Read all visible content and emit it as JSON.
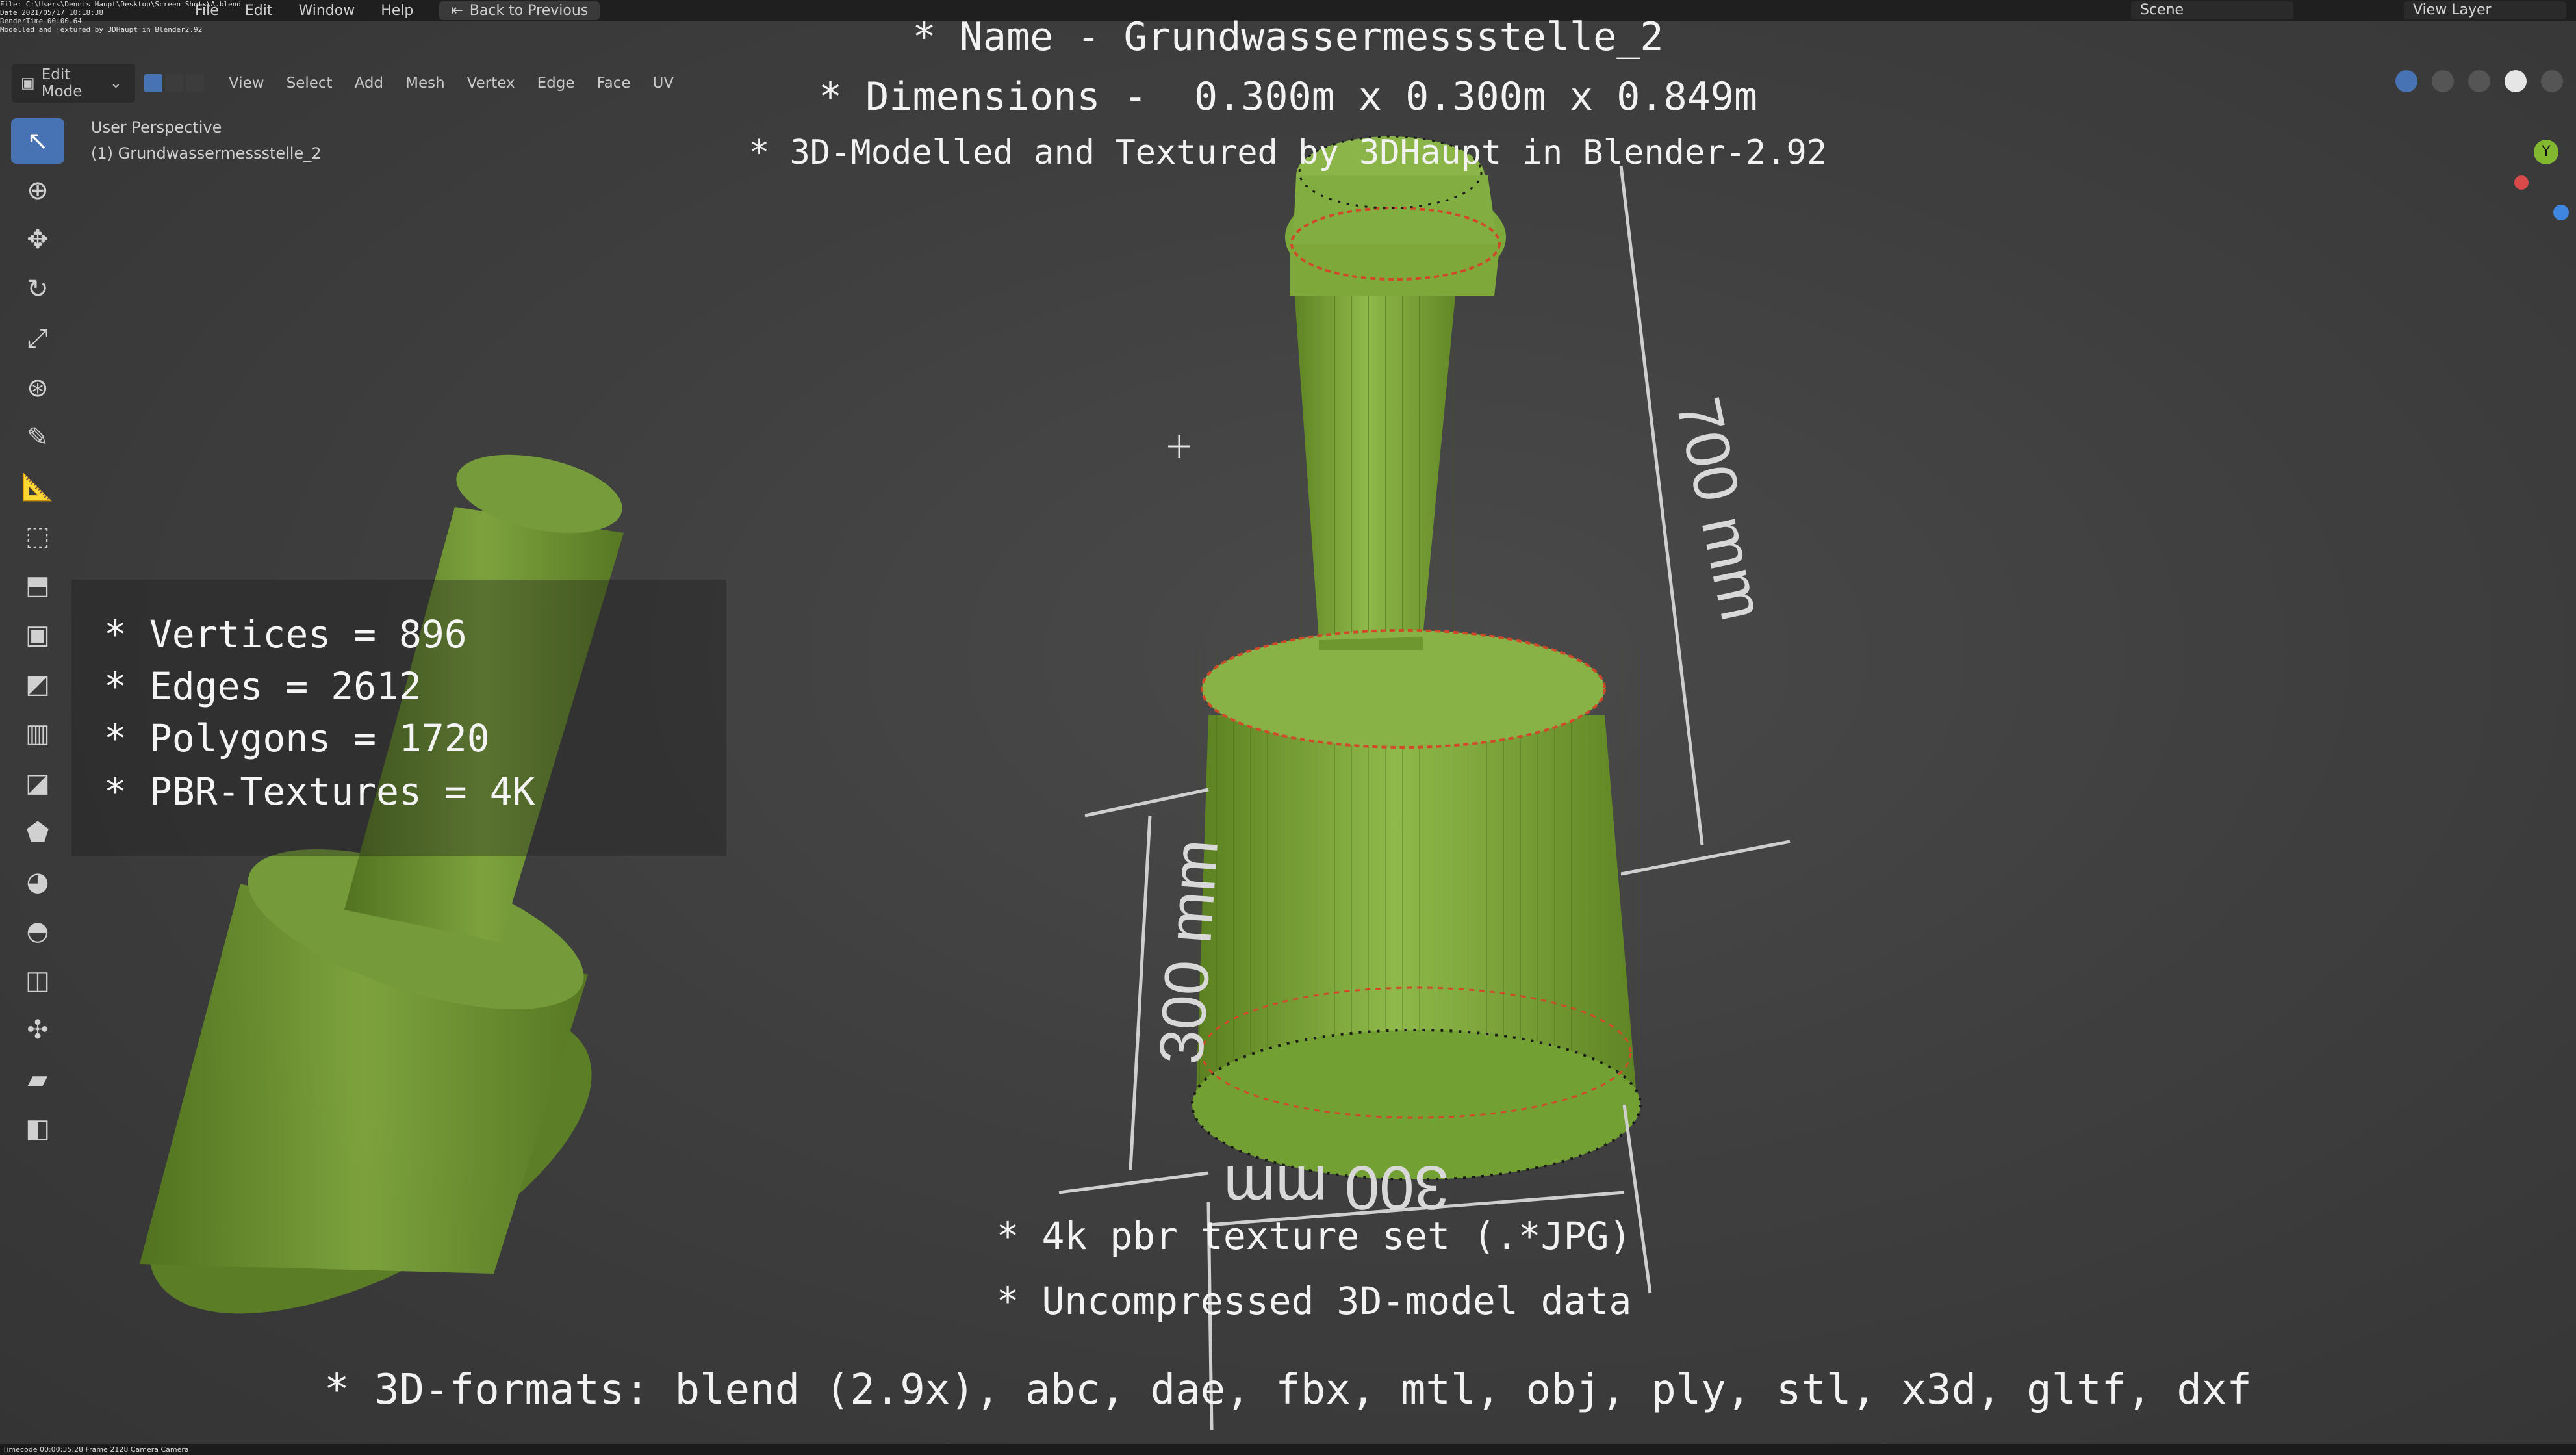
{
  "window": {
    "menu": [
      "File",
      "Edit",
      "Window",
      "Help"
    ],
    "back_label": "Back to Previous",
    "scene": "Scene",
    "view_layer": "View Layer",
    "tiny_info": "File: C:\\Users\\Dennis Haupt\\Desktop\\Screen Shots\\A.blend\nDate 2021/05/17 10:18:38\nRenderTime 00:00.64\nModelled and Textured by 3DHaupt in Blender2.92"
  },
  "header": {
    "mode": "Edit Mode",
    "menus": [
      "View",
      "Select",
      "Add",
      "Mesh",
      "Vertex",
      "Edge",
      "Face",
      "UV"
    ]
  },
  "viewport": {
    "perspective": "User Perspective",
    "object": "(1) Grundwassermessstelle_2"
  },
  "overlay": {
    "name_line": "* Name - Grundwassermessstelle_2",
    "dimensions_line": "* Dimensions -  0.300m x 0.300m x 0.849m",
    "credit_line": "* 3D-Modelled and Textured by 3DHaupt in Blender-2.92",
    "stats": [
      "* Vertices = 896",
      "* Edges = 2612",
      "* Polygons = 1720",
      "* PBR-Textures = 4K"
    ],
    "texture_line": "* 4k pbr texture set (.*JPG)",
    "uncompressed_line": "* Uncompressed 3D-model data",
    "formats_line": "* 3D-formats: blend (2.9x), abc, dae, fbx, mtl, obj, ply, stl, x3d, gltf, dxf"
  },
  "dimensions": {
    "height_label": "700 mm",
    "base_height_label": "300 mm",
    "width_label": "300 mm"
  },
  "gizmo": {
    "y": "Y"
  },
  "statusbar": {
    "text": "Timecode 00:00:35:28   Frame 2128   Camera Camera"
  },
  "colors": {
    "model_green": "#7fa83a",
    "selection_blue": "#4772b3"
  },
  "icons": [
    "select-icon",
    "cursor-icon",
    "move-icon",
    "rotate-icon",
    "scale-icon",
    "transform-icon",
    "annotate-icon",
    "measure-icon",
    "add-cube-icon",
    "extrude-icon",
    "inset-icon",
    "bevel-icon",
    "loop-cut-icon",
    "knife-icon",
    "poly-build-icon",
    "spin-icon",
    "smooth-icon",
    "edge-slide-icon",
    "shrink-icon",
    "shear-icon",
    "rip-icon"
  ]
}
